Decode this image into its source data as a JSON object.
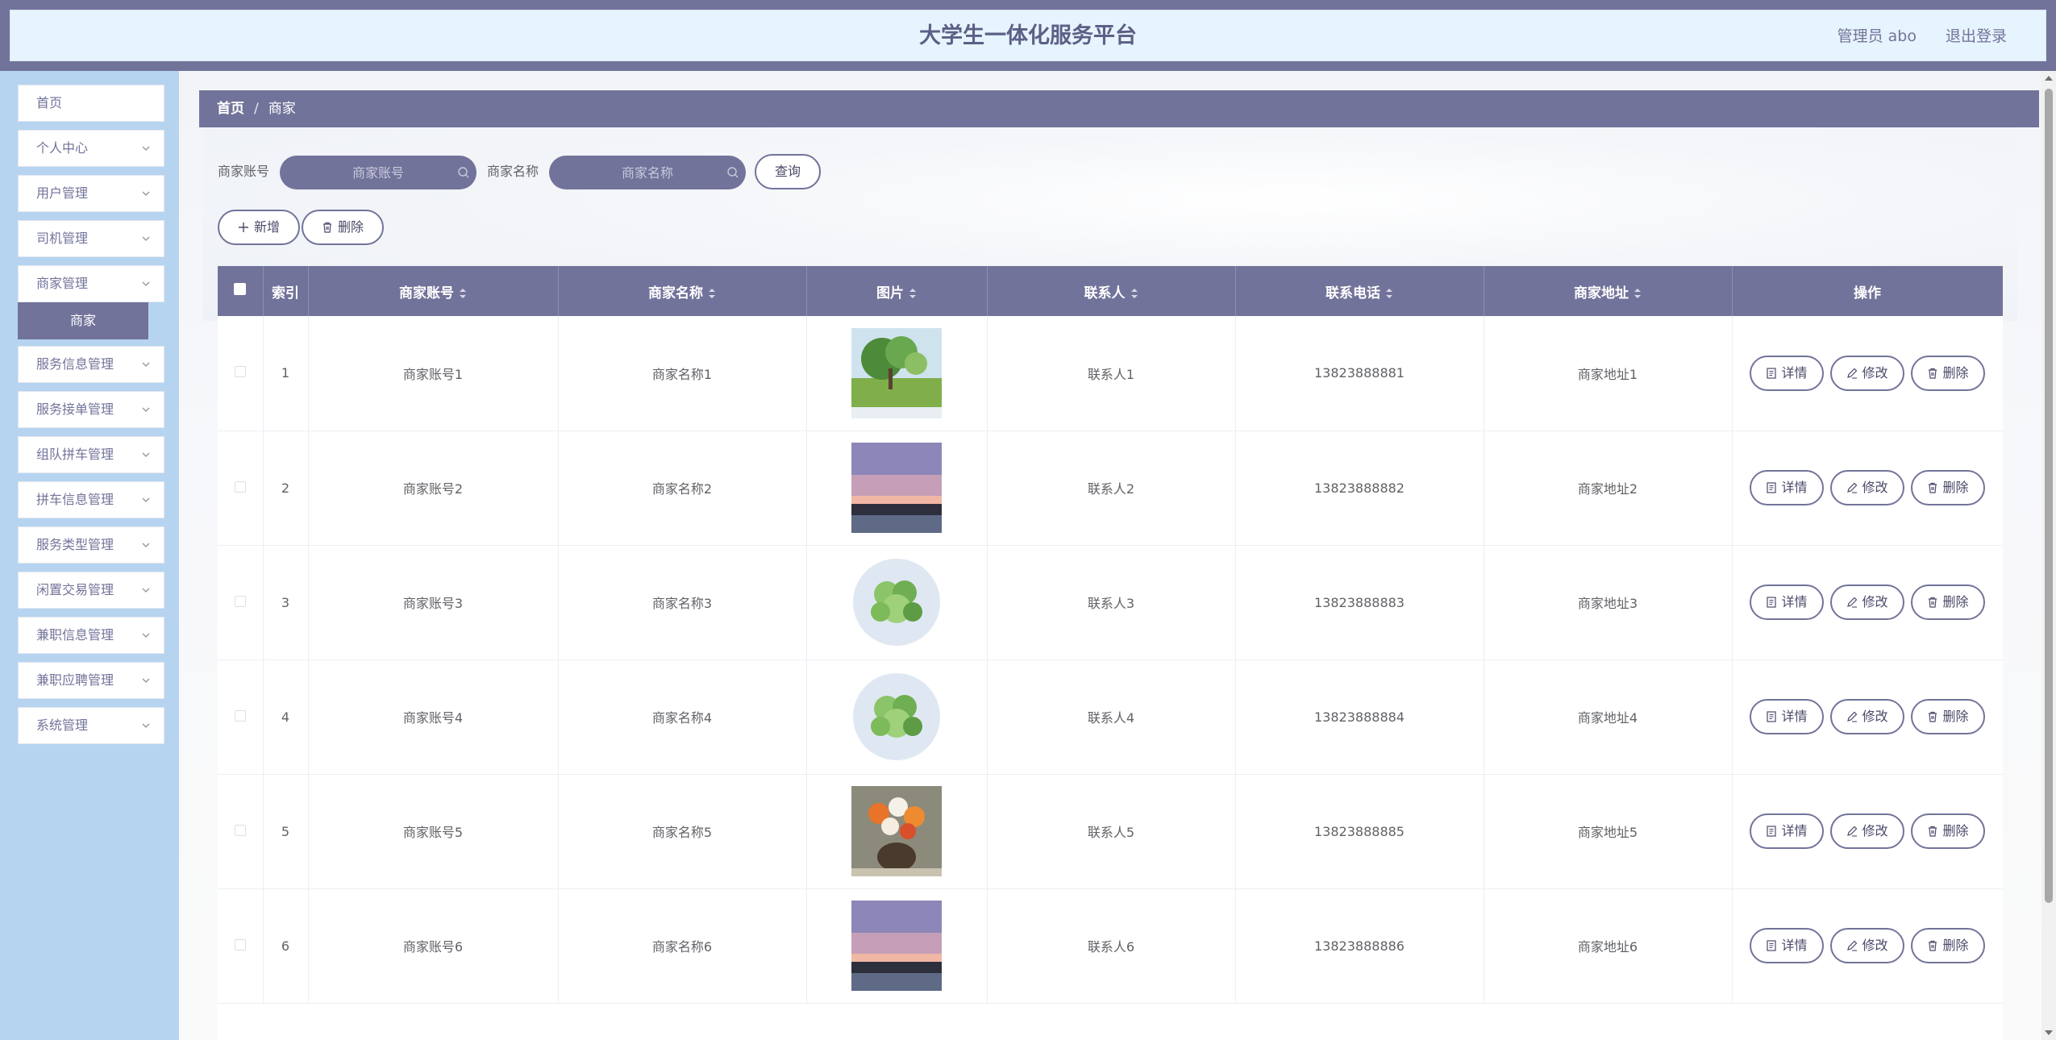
{
  "header": {
    "title": "大学生一体化服务平台",
    "user": "管理员 abo",
    "logout": "退出登录"
  },
  "sidebar": {
    "items": [
      {
        "label": "首页",
        "has_children": false
      },
      {
        "label": "个人中心",
        "has_children": true
      },
      {
        "label": "用户管理",
        "has_children": true
      },
      {
        "label": "司机管理",
        "has_children": true
      },
      {
        "label": "商家管理",
        "has_children": true,
        "expanded": true
      },
      {
        "label": "服务信息管理",
        "has_children": true
      },
      {
        "label": "服务接单管理",
        "has_children": true
      },
      {
        "label": "组队拼车管理",
        "has_children": true
      },
      {
        "label": "拼车信息管理",
        "has_children": true
      },
      {
        "label": "服务类型管理",
        "has_children": true
      },
      {
        "label": "闲置交易管理",
        "has_children": true
      },
      {
        "label": "兼职信息管理",
        "has_children": true
      },
      {
        "label": "兼职应聘管理",
        "has_children": true
      },
      {
        "label": "系统管理",
        "has_children": true
      }
    ],
    "active_sub": "商家"
  },
  "breadcrumb": {
    "home": "首页",
    "separator": "/",
    "current": "商家"
  },
  "search": {
    "account_label": "商家账号",
    "account_placeholder": "商家账号",
    "name_label": "商家名称",
    "name_placeholder": "商家名称",
    "query_button": "查询"
  },
  "actions": {
    "add": "新增",
    "delete": "删除"
  },
  "table": {
    "headers": {
      "index": "索引",
      "account": "商家账号",
      "name": "商家名称",
      "image": "图片",
      "contact": "联系人",
      "phone": "联系电话",
      "address": "商家地址",
      "ops": "操作"
    },
    "op_labels": {
      "detail": "详情",
      "edit": "修改",
      "delete": "删除"
    },
    "rows": [
      {
        "index": "1",
        "account": "商家账号1",
        "name": "商家名称1",
        "image": "landscape-tree",
        "contact": "联系人1",
        "phone": "13823888881",
        "address": "商家地址1"
      },
      {
        "index": "2",
        "account": "商家账号2",
        "name": "商家名称2",
        "image": "sunset-sky",
        "contact": "联系人2",
        "phone": "13823888882",
        "address": "商家地址2"
      },
      {
        "index": "3",
        "account": "商家账号3",
        "name": "商家名称3",
        "image": "green-plant",
        "contact": "联系人3",
        "phone": "13823888883",
        "address": "商家地址3"
      },
      {
        "index": "4",
        "account": "商家账号4",
        "name": "商家名称4",
        "image": "green-plant",
        "contact": "联系人4",
        "phone": "13823888884",
        "address": "商家地址4"
      },
      {
        "index": "5",
        "account": "商家账号5",
        "name": "商家名称5",
        "image": "flower-vase",
        "contact": "联系人5",
        "phone": "13823888885",
        "address": "商家地址5"
      },
      {
        "index": "6",
        "account": "商家账号6",
        "name": "商家名称6",
        "image": "sunset-sky",
        "contact": "联系人6",
        "phone": "13823888886",
        "address": "商家地址6"
      }
    ]
  },
  "colors": {
    "primary": "#72739a",
    "header_bg": "#e6f4fd",
    "sidebar_bg": "#b6d4f0"
  }
}
